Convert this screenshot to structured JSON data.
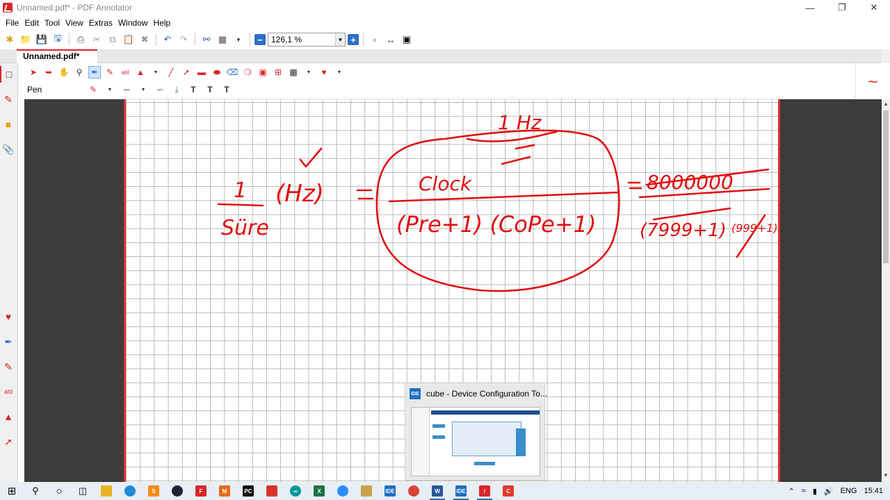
{
  "window": {
    "title": "Unnamed.pdf* - PDF Annotator"
  },
  "menu": [
    "File",
    "Edit",
    "Tool",
    "View",
    "Extras",
    "Window",
    "Help"
  ],
  "toolbar": {
    "zoom_value": "126,1 %"
  },
  "tabs": [
    {
      "label": "Unnamed.pdf*"
    }
  ],
  "annotation_toolbar": {
    "tool_label": "Pen"
  },
  "handwriting": {
    "freq_label": "1 Hz",
    "numerator": "1",
    "denominator": "Süre",
    "unit": "(Hz)",
    "clock": "Clock",
    "divisor": "(Pre+1) (CoPe+1)",
    "value": "8000000",
    "prescaler": "(7999+1)",
    "period": "(999+1)"
  },
  "preview": {
    "title": "cube - Device Configuration To..."
  },
  "taskbar": {
    "language": "ENG",
    "time": "15:41"
  },
  "colors": {
    "accent": "#d9252a",
    "ink": "#e01010",
    "grid": "#b9b9b9"
  }
}
